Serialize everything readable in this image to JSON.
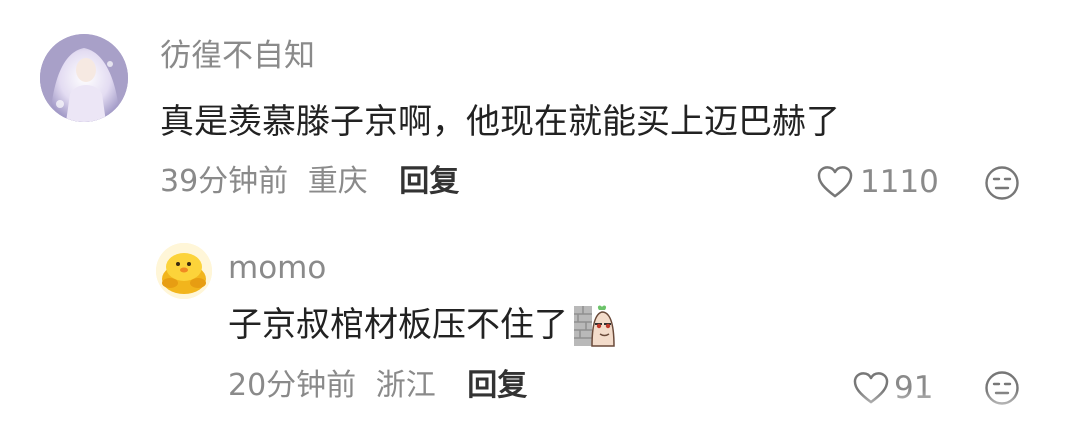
{
  "comment": {
    "username": "彷徨不自知",
    "text": "真是羡慕滕子京啊，他现在就能买上迈巴赫了",
    "time": "39分钟前",
    "location": "重庆",
    "reply_label": "回复",
    "like_count": "1110"
  },
  "reply": {
    "username": "momo",
    "text": "子京叔棺材板压不住了",
    "time": "20分钟前",
    "location": "浙江",
    "reply_label": "回复",
    "like_count": "91"
  },
  "colors": {
    "text_primary": "#222222",
    "text_secondary": "#8a8a8a",
    "reply_button": "#333333"
  }
}
